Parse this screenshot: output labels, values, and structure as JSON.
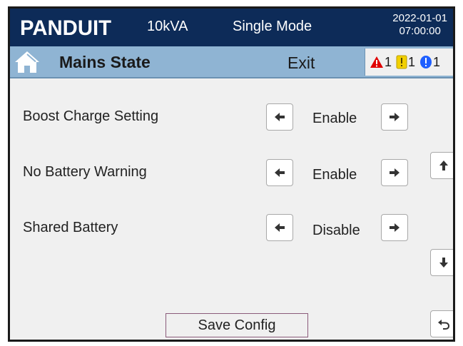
{
  "header": {
    "logo_text": "PANDUIT",
    "capacity": "10kVA",
    "mode": "Single Mode",
    "date": "2022-01-01",
    "time": "07:00:00"
  },
  "nav": {
    "home_icon": "home-icon",
    "title": "Mains State",
    "exit_label": "Exit",
    "alarms": {
      "critical_count": "1",
      "warning_count": "1",
      "info_count": "1"
    },
    "colors": {
      "critical": "#e00000",
      "warning": "#f2d000",
      "info": "#1e5fff"
    }
  },
  "settings": [
    {
      "label": "Boost Charge Setting",
      "value": "Enable"
    },
    {
      "label": "No Battery Warning",
      "value": "Enable"
    },
    {
      "label": "Shared Battery",
      "value": "Disable"
    }
  ],
  "footer": {
    "save_label": "Save Config"
  }
}
